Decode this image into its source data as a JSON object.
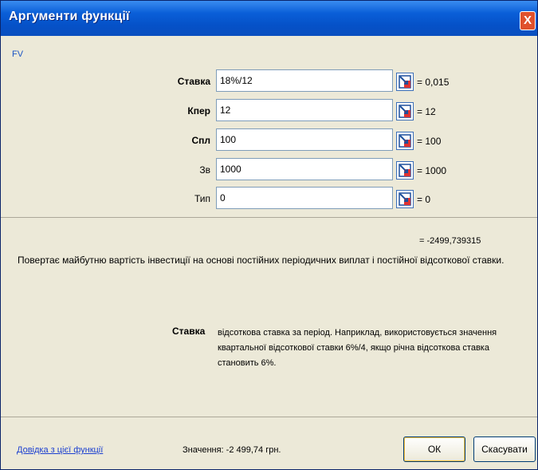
{
  "window": {
    "title": "Аргументи функції",
    "close_label": "X"
  },
  "function_name": "FV",
  "arguments": [
    {
      "label": "Ставка",
      "bold": true,
      "value": "18%/12",
      "result": "= 0,015"
    },
    {
      "label": "Кпер",
      "bold": true,
      "value": "12",
      "result": "= 12"
    },
    {
      "label": "Спл",
      "bold": true,
      "value": "100",
      "result": "= 100"
    },
    {
      "label": "Зв",
      "bold": false,
      "value": "1000",
      "result": "= 1000"
    },
    {
      "label": "Тип",
      "bold": false,
      "value": "0",
      "result": "= 0"
    }
  ],
  "formula_result": "= -2499,739315",
  "description": "Повертає майбутню вартість інвестиції на основі постійних періодичних виплат і постійної відсоткової ставки.",
  "argument_help": {
    "name": "Ставка",
    "text": "відсоткова ставка за період. Наприклад, використовується значення квартальної відсоткової ставки 6%/4, якщо річна відсоткова ставка становить 6%."
  },
  "footer": {
    "help_link": "Довідка з цієї функції",
    "value_label": "Значення: -2 499,74 грн.",
    "ok_label": "ОК",
    "cancel_label": "Скасувати"
  },
  "icons": {
    "collapse": "collapse-dialog-icon"
  },
  "colors": {
    "title_bar": "#0551c8",
    "dialog_bg": "#ece9d8",
    "close_button": "#e0512c",
    "link": "#1b3fd0"
  }
}
